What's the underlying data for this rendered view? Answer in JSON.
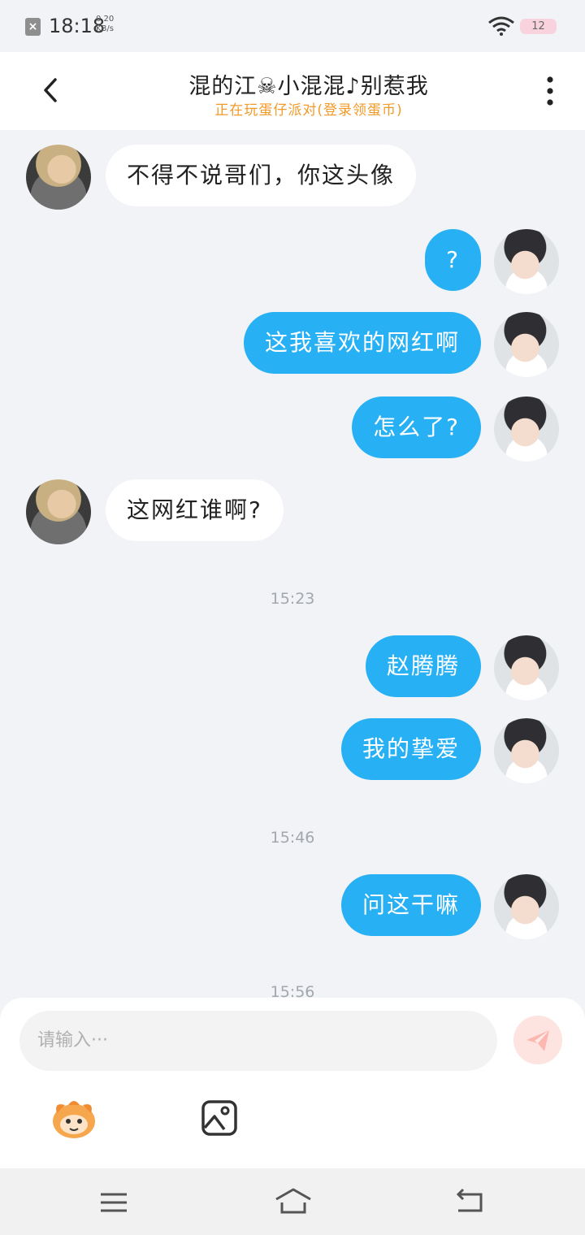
{
  "status_bar": {
    "time": "18:18",
    "net_speed_value": "0.20",
    "net_speed_unit": "KB/s",
    "battery": "12"
  },
  "header": {
    "title": "混的江☠小混混♪别惹我",
    "subtitle": "正在玩蛋仔派对(登录领蛋币)"
  },
  "messages": [
    {
      "side": "in",
      "text": "不得不说哥们，你这头像"
    },
    {
      "side": "out",
      "text": "?"
    },
    {
      "side": "out",
      "text": "这我喜欢的网红啊"
    },
    {
      "side": "out",
      "text": "怎么了?"
    },
    {
      "side": "in",
      "text": "这网红谁啊?"
    },
    {
      "time": "15:23"
    },
    {
      "side": "out",
      "text": "赵腾腾"
    },
    {
      "side": "out",
      "text": "我的挚爱"
    },
    {
      "time": "15:46"
    },
    {
      "side": "out",
      "text": "问这干嘛"
    },
    {
      "time": "15:56"
    }
  ],
  "input": {
    "placeholder": "请输入···"
  },
  "colors": {
    "accent": "#27b0f4",
    "background": "#f1f3f6",
    "subtitle": "#f29a28"
  },
  "icons": {
    "back": "chevron-left-icon",
    "more": "more-vertical-icon",
    "send": "send-icon",
    "emoji": "emoji-sticker-icon",
    "image": "image-icon"
  }
}
